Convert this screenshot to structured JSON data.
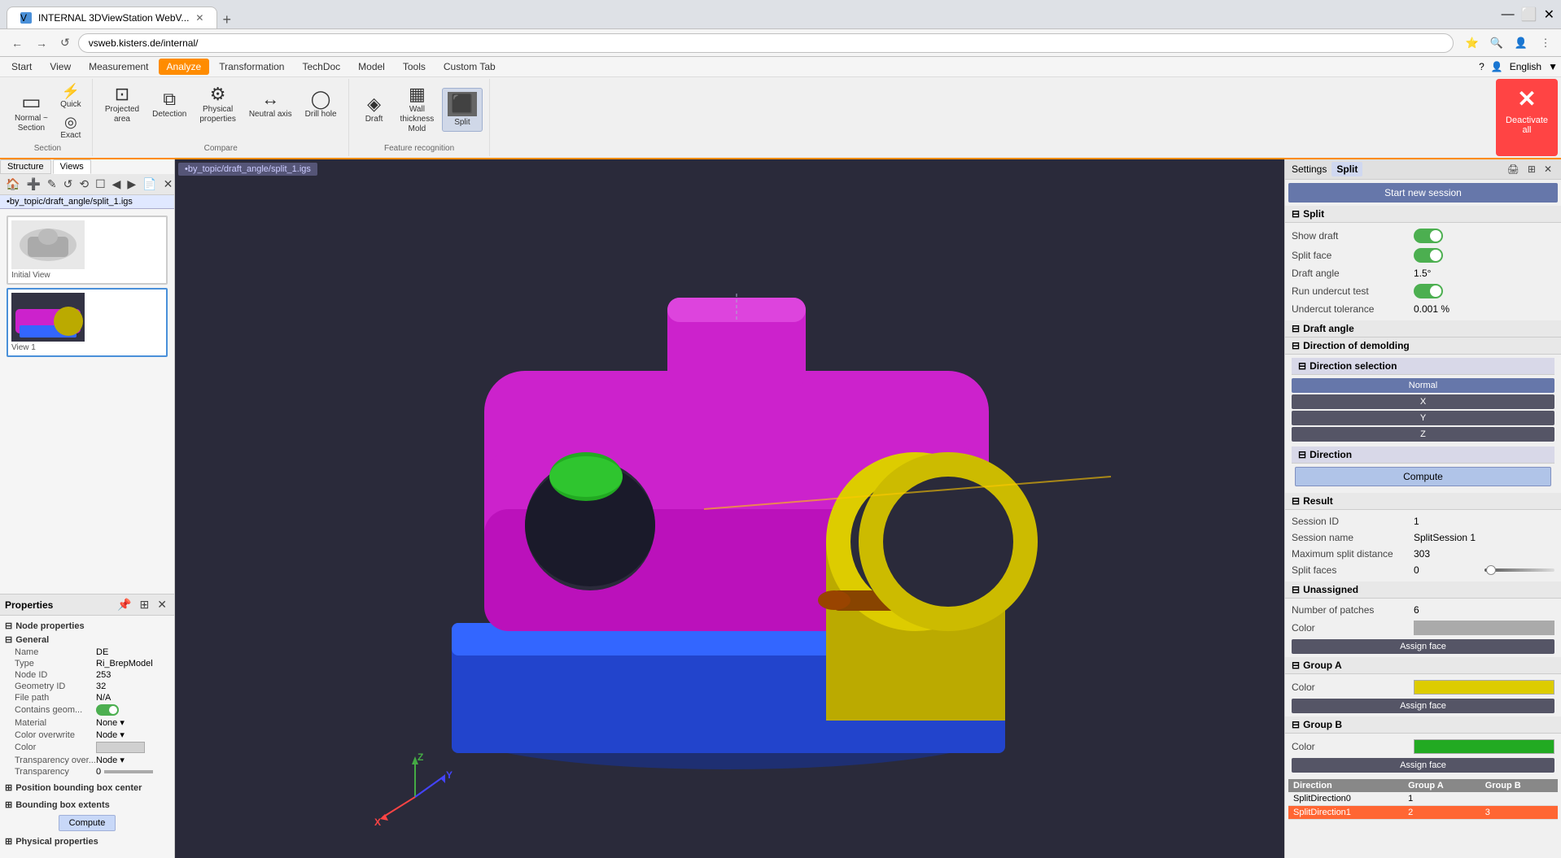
{
  "browser": {
    "tab_title": "INTERNAL 3DViewStation WebV...",
    "tab_favicon": "V",
    "url": "vsweb.kisters.de/internal/",
    "new_tab_label": "+",
    "nav_back": "←",
    "nav_forward": "→",
    "nav_reload": "↺"
  },
  "menu": {
    "items": [
      "Start",
      "View",
      "Measurement",
      "Analyze",
      "Transformation",
      "TechDoc",
      "Model",
      "Tools",
      "Custom Tab"
    ],
    "active": "Analyze",
    "right_items": [
      "🌐",
      "?",
      "👤",
      "English",
      "▼"
    ]
  },
  "ribbon": {
    "groups": [
      {
        "label": "Section",
        "buttons": [
          {
            "id": "normal-section",
            "icon": "▭",
            "label": "Normal ~\nSection",
            "active": false
          },
          {
            "id": "quick",
            "icon": "⚡",
            "label": "Quick",
            "active": false
          },
          {
            "id": "exact",
            "icon": "◎",
            "label": "Exact",
            "active": false
          }
        ]
      },
      {
        "label": "Compare",
        "buttons": [
          {
            "id": "projected-area",
            "icon": "⊡",
            "label": "Projected\narea",
            "active": false
          },
          {
            "id": "detection",
            "icon": "⧉",
            "label": "Detection",
            "active": false
          },
          {
            "id": "physical-props",
            "icon": "⚙",
            "label": "Physical\nproperties",
            "active": false
          },
          {
            "id": "neutral-axis",
            "icon": "↔",
            "label": "Neutral axis",
            "active": false
          },
          {
            "id": "drill-hole",
            "icon": "◯",
            "label": "Drill hole",
            "active": false
          }
        ]
      },
      {
        "label": "Feature recognition",
        "buttons": [
          {
            "id": "draft",
            "icon": "◈",
            "label": "Draft",
            "active": false
          },
          {
            "id": "wall-thickness",
            "icon": "▦",
            "label": "Wall\nthickness\nMold",
            "active": false
          },
          {
            "id": "split",
            "icon": "⬛",
            "label": "Split",
            "active": true
          }
        ]
      }
    ],
    "deactivate_label": "Deactivate\nall",
    "deactivate_icon": "✕"
  },
  "left_panel": {
    "header_tabs": [
      "Structure",
      "Views"
    ],
    "active_tab": "Views",
    "toolbar_icons": [
      "🏠",
      "➕",
      "✎",
      "↺",
      "⟲",
      "☐",
      "◀",
      "▶",
      "📄"
    ],
    "file_tab": "•by_topic/draft_angle/split_1.igs",
    "views": [
      {
        "label": "Initial View",
        "active": false
      },
      {
        "label": "View 1",
        "active": true
      }
    ]
  },
  "properties_panel": {
    "title": "Properties",
    "section_node": "Node properties",
    "section_general": "General",
    "rows": [
      {
        "label": "Name",
        "value": "DE"
      },
      {
        "label": "Type",
        "value": "Ri_BrepModel"
      },
      {
        "label": "Node ID",
        "value": "253"
      },
      {
        "label": "Geometry ID",
        "value": "32"
      },
      {
        "label": "File path",
        "value": "N/A"
      },
      {
        "label": "Contains geom...",
        "value": "toggle_on"
      },
      {
        "label": "Material",
        "value": "None",
        "dropdown": true
      },
      {
        "label": "Color overwrite",
        "value": "Node",
        "dropdown": true
      },
      {
        "label": "Color",
        "value": "color_swatch"
      },
      {
        "label": "Transparency over...",
        "value": "Node",
        "dropdown": true
      },
      {
        "label": "Transparency",
        "value": "0",
        "slider": true
      }
    ],
    "section_position": "Position bounding box center",
    "section_bounding": "Bounding box extents",
    "compute_label": "Compute",
    "section_physical": "Physical properties"
  },
  "viewport": {
    "breadcrumb": "•by_topic/draft_angle/split_1.igs",
    "axes": {
      "x_label": "X",
      "y_label": "Y",
      "z_label": "Z"
    }
  },
  "right_panel": {
    "title_settings": "Settings",
    "title_split": "Split",
    "header_btns": [
      "🖨",
      "⊞",
      "✕"
    ],
    "start_session_label": "Start new session",
    "section_split": "Split",
    "show_draft_label": "Show draft",
    "show_draft_value": "on",
    "split_face_label": "Split face",
    "split_face_value": "on",
    "draft_angle_label": "Draft angle",
    "draft_angle_value": "1.5°",
    "run_undercut_label": "Run undercut test",
    "run_undercut_value": "on",
    "undercut_tolerance_label": "Undercut tolerance",
    "undercut_tolerance_value": "0.001 %",
    "section_draft_angle": "Draft angle",
    "section_direction_demolding": "Direction of demolding",
    "section_direction_selection": "Direction selection",
    "direction_btns": [
      "Normal",
      "X",
      "Y",
      "Z"
    ],
    "active_direction": "Normal",
    "section_direction": "Direction",
    "compute_label": "Compute",
    "section_result": "Result",
    "session_id_label": "Session ID",
    "session_id_value": "1",
    "session_name_label": "Session name",
    "session_name_value": "SplitSession 1",
    "max_split_dist_label": "Maximum split distance",
    "max_split_dist_value": "303",
    "split_faces_label": "Split faces",
    "split_faces_value": "0",
    "section_unassigned": "Unassigned",
    "num_patches_label": "Number of patches",
    "num_patches_value": "6",
    "unassigned_color_label": "Color",
    "unassigned_color": "gray",
    "assign_face_label": "Assign face",
    "section_group_a": "Group A",
    "group_a_color_label": "Color",
    "group_a_color": "yellow",
    "group_a_assign_face_label": "Assign face",
    "section_group_b": "Group B",
    "group_b_color_label": "Color",
    "group_b_color": "green",
    "group_b_assign_face_label": "Assign face",
    "table_headers": [
      "Direction",
      "Group A",
      "Group B"
    ],
    "table_rows": [
      {
        "direction": "SplitDirection0",
        "group_a": "1",
        "group_b": "",
        "highlight": false
      },
      {
        "direction": "SplitDirection1",
        "group_a": "2",
        "group_b": "3",
        "highlight": true
      }
    ]
  }
}
